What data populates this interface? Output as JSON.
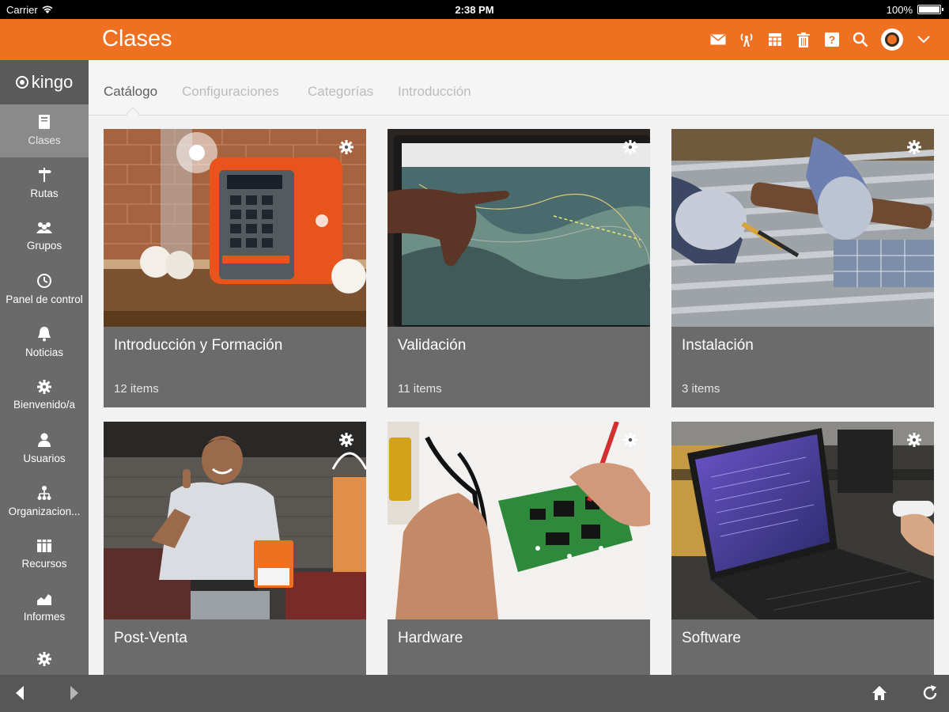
{
  "status": {
    "carrier": "Carrier",
    "time": "2:38 PM",
    "battery": "100%",
    "battery_level": 1.0
  },
  "header": {
    "title": "Clases",
    "accent": "#f07022",
    "icons": [
      "mail-icon",
      "antenna-icon",
      "calendar-icon",
      "trash-icon",
      "help-icon",
      "search-icon",
      "avatar",
      "chevron-down-icon"
    ]
  },
  "sidebar": {
    "logo": "kingo",
    "items": [
      {
        "label": "Clases",
        "icon": "book-icon",
        "active": true
      },
      {
        "label": "Rutas",
        "icon": "signpost-icon"
      },
      {
        "label": "Grupos",
        "icon": "group-icon"
      },
      {
        "label": "Panel de control",
        "icon": "dashboard-icon"
      },
      {
        "label": "Noticias",
        "icon": "bell-icon"
      },
      {
        "label": "Bienvenido/a",
        "icon": "gear-icon"
      },
      {
        "label": "Usuarios",
        "icon": "user-icon"
      },
      {
        "label": "Organizacion...",
        "icon": "org-icon"
      },
      {
        "label": "Recursos",
        "icon": "resources-icon"
      },
      {
        "label": "Informes",
        "icon": "chart-icon"
      },
      {
        "label": "",
        "icon": "gear-icon"
      }
    ]
  },
  "tabs": [
    {
      "label": "Catálogo",
      "active": true
    },
    {
      "label": "Configuraciones"
    },
    {
      "label": "Categorías"
    },
    {
      "label": "Introducción"
    }
  ],
  "cards": [
    {
      "title": "Introducción y Formación",
      "count": "12 items",
      "image": "orange-device-photo"
    },
    {
      "title": "Validación",
      "count": "11 items",
      "image": "map-screen-photo"
    },
    {
      "title": "Instalación",
      "count": "3 items",
      "image": "solar-panel-photo"
    },
    {
      "title": "Post-Venta",
      "count": "",
      "image": "smiling-technician-photo"
    },
    {
      "title": "Hardware",
      "count": "",
      "image": "circuit-board-photo"
    },
    {
      "title": "Software",
      "count": "",
      "image": "laptop-photo"
    }
  ],
  "toolbar": {
    "icons": [
      "back-icon",
      "forward-icon",
      "home-icon",
      "refresh-icon"
    ]
  }
}
